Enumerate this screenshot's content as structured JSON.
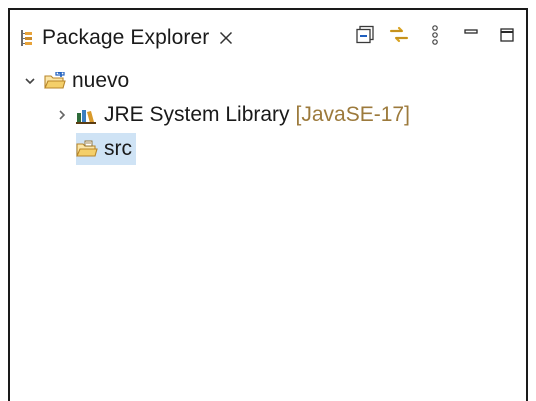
{
  "view": {
    "title": "Package Explorer",
    "icons": {
      "tab": "package-explorer-icon",
      "close": "close-icon",
      "collapse_all": "collapse-all-icon",
      "link_with_editor": "link-with-editor-icon",
      "view_menu": "view-menu-icon",
      "minimize": "minimize-icon",
      "maximize": "maximize-icon"
    }
  },
  "tree": {
    "project": {
      "label": "nuevo",
      "expanded": true,
      "icon": "java-project-folder-icon"
    },
    "jre": {
      "label": "JRE System Library",
      "decoration": "[JavaSE-17]",
      "expanded": false,
      "icon": "library-icon"
    },
    "src": {
      "label": "src",
      "selected": true,
      "icon": "source-folder-icon"
    }
  },
  "colors": {
    "selection": "#cfe3f5",
    "decoration": "#9c7a3c",
    "folder": "#e8b44a",
    "accent": "#1f5fbf"
  }
}
